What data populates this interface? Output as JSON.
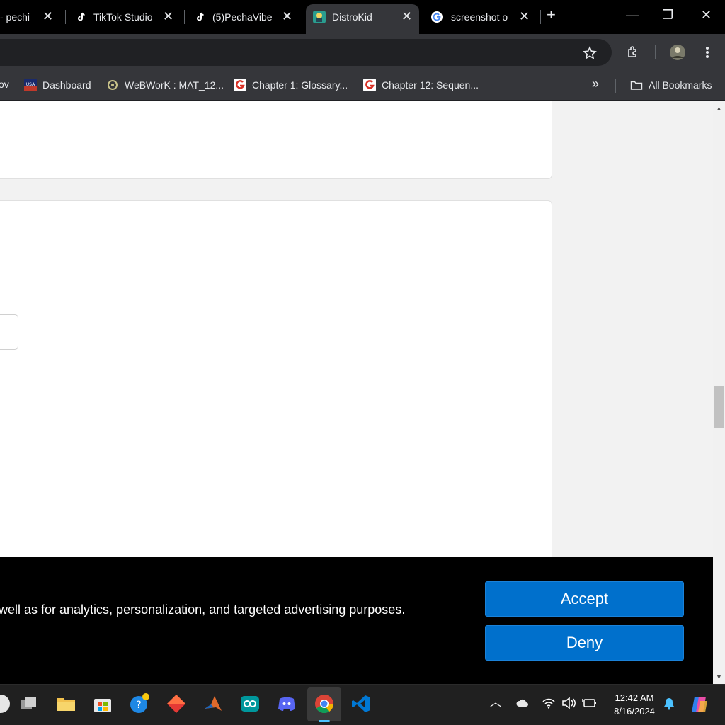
{
  "tabs": [
    {
      "title": "- pechi",
      "close": "✕",
      "icon": "tab-favicon"
    },
    {
      "title": "TikTok Studio",
      "close": "✕",
      "icon": "tiktok-icon"
    },
    {
      "title": "(5)PechaVibe",
      "close": "✕",
      "icon": "tiktok-icon"
    },
    {
      "title": "DistroKid",
      "close": "✕",
      "icon": "distrokid-icon",
      "active": true
    },
    {
      "title": "screenshot o",
      "close": "✕",
      "icon": "google-icon"
    }
  ],
  "new_tab": "+",
  "window_controls": {
    "minimize": "—",
    "restore": "❐",
    "close": "✕"
  },
  "bookmarks": [
    {
      "label": "ov",
      "icon": "bookmark-icon"
    },
    {
      "label": "Dashboard",
      "icon": "usa-icon"
    },
    {
      "label": "WeBWorK : MAT_12...",
      "icon": "webwork-icon"
    },
    {
      "label": "Chapter 1: Glossary...",
      "icon": "chapter-icon"
    },
    {
      "label": "Chapter 12: Sequen...",
      "icon": "chapter-icon"
    }
  ],
  "bookmarks_overflow": "»",
  "all_bookmarks": "All Bookmarks",
  "cookie_banner": {
    "text": "well as for analytics, personalization, and targeted advertising purposes.",
    "accept": "Accept",
    "deny": "Deny"
  },
  "clock": {
    "time": "12:42 AM",
    "date": "8/16/2024"
  },
  "colors": {
    "accent_button": "#0070cc",
    "active_tab": "#35363a"
  }
}
